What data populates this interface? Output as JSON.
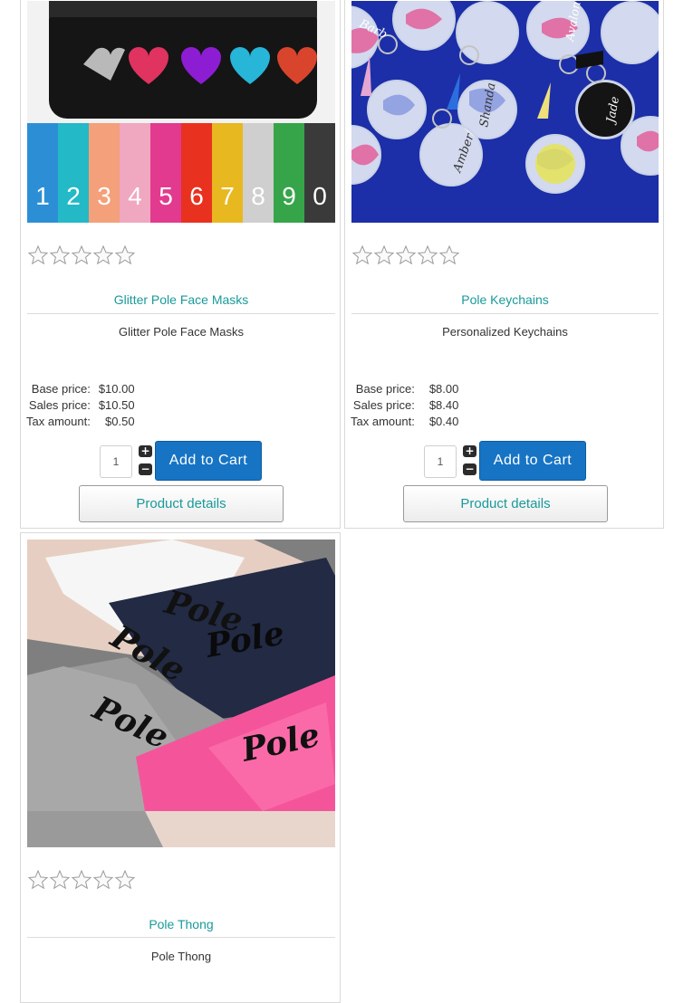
{
  "products": [
    {
      "title": "Glitter Pole Face Masks",
      "description": "Glitter Pole Face Masks",
      "rating": "0",
      "rating_max": "5",
      "price_labels": [
        "Base price:",
        "Sales price:",
        "Tax amount:"
      ],
      "price_values": [
        "$10.00",
        "$10.50",
        "$0.50"
      ],
      "quantity": "1",
      "add_to_cart": "Add to Cart",
      "details": "Product details",
      "swatch_numbers": [
        "1",
        "2",
        "3",
        "4",
        "5",
        "6",
        "7",
        "8",
        "9",
        "0"
      ],
      "swatch_colors": [
        "#2c8fd6",
        "#23b9c7",
        "#f4a07a",
        "#f0a7c0",
        "#e23a8f",
        "#e8321f",
        "#e8b820",
        "#cfcfcf",
        "#36a54a",
        "#3a3a3a"
      ]
    },
    {
      "title": "Pole Keychains",
      "description": "Personalized Keychains",
      "rating": "0",
      "rating_max": "5",
      "price_labels": [
        "Base price:",
        "Sales price:",
        "Tax amount:"
      ],
      "price_values": [
        "$8.00",
        "$8.40",
        "$0.40"
      ],
      "quantity": "1",
      "add_to_cart": "Add to Cart",
      "details": "Product details",
      "keychain_names": [
        "Barb",
        "Amber",
        "Shanda",
        "Avalon",
        "Jade"
      ]
    },
    {
      "title": "Pole Thong",
      "description": "Pole Thong",
      "rating": "0",
      "rating_max": "5",
      "print_text": "Pole"
    }
  ],
  "colors": {
    "title_link": "#1a9a9a",
    "cart_button": "#1774c4",
    "border": "#d9d9d9"
  },
  "icons": {
    "rating": "star-outline-icon",
    "increment": "plus-icon",
    "decrement": "minus-icon"
  }
}
